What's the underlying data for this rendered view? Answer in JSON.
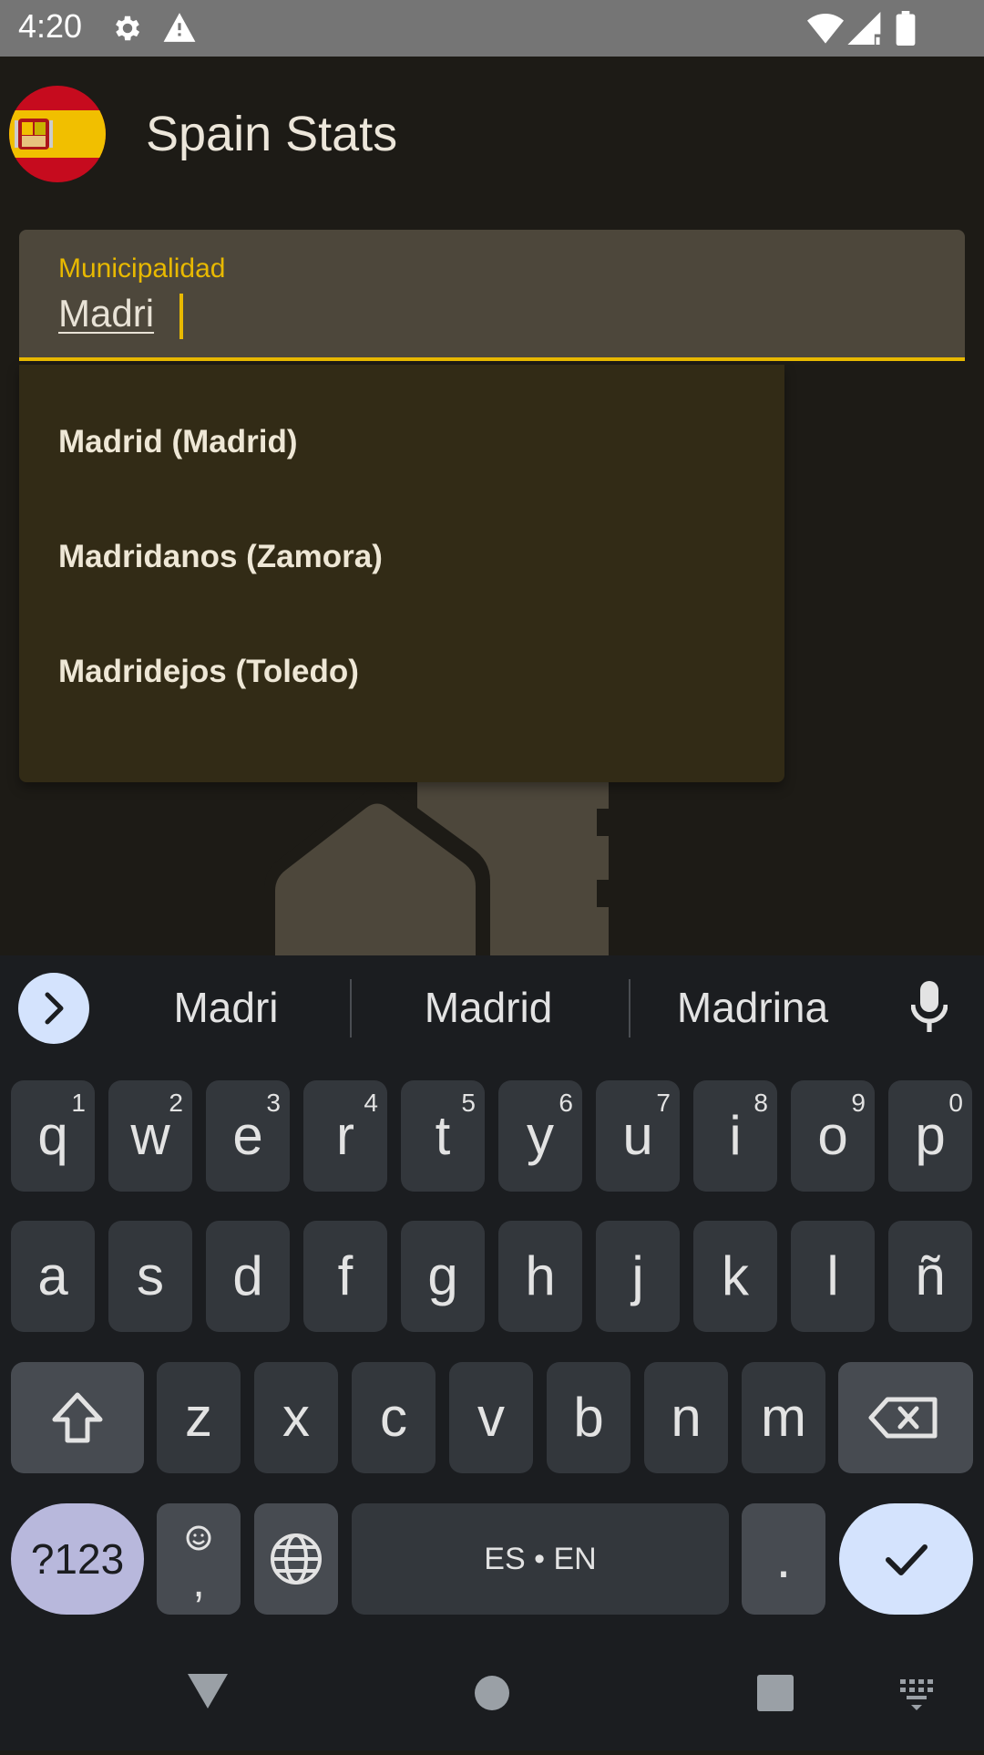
{
  "status_bar": {
    "time": "4:20"
  },
  "app": {
    "title": "Spain Stats"
  },
  "search_field": {
    "label": "Municipalidad",
    "value": "Madri"
  },
  "dropdown": {
    "items": [
      "Madrid (Madrid)",
      "Madridanos (Zamora)",
      "Madridejos (Toledo)"
    ]
  },
  "keyboard": {
    "suggestions": [
      "Madri",
      "Madrid",
      "Madrina"
    ],
    "row1": [
      {
        "k": "q",
        "h": "1"
      },
      {
        "k": "w",
        "h": "2"
      },
      {
        "k": "e",
        "h": "3"
      },
      {
        "k": "r",
        "h": "4"
      },
      {
        "k": "t",
        "h": "5"
      },
      {
        "k": "y",
        "h": "6"
      },
      {
        "k": "u",
        "h": "7"
      },
      {
        "k": "i",
        "h": "8"
      },
      {
        "k": "o",
        "h": "9"
      },
      {
        "k": "p",
        "h": "0"
      }
    ],
    "row2": [
      "a",
      "s",
      "d",
      "f",
      "g",
      "h",
      "j",
      "k",
      "l",
      "ñ"
    ],
    "row3": [
      "z",
      "x",
      "c",
      "v",
      "b",
      "n",
      "m"
    ],
    "symbols_label": "?123",
    "comma_label": ",",
    "space_label": "ES • EN",
    "period_label": "."
  }
}
